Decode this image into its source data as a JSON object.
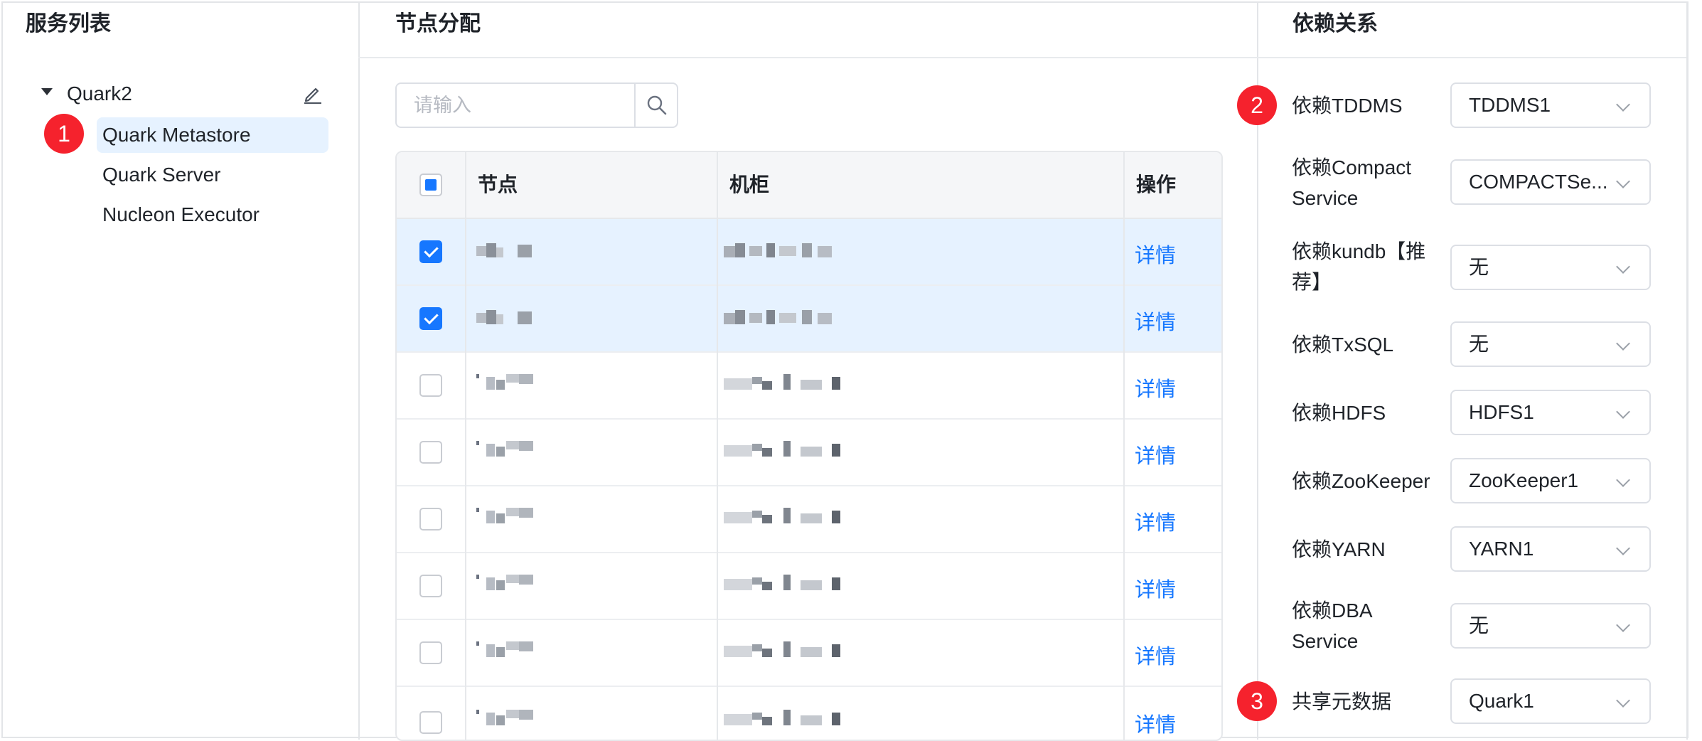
{
  "left_panel": {
    "title": "服务列表",
    "root": "Quark2",
    "items": [
      "Quark Metastore",
      "Quark Server",
      "Nucleon Executor"
    ],
    "selected_index": 0
  },
  "middle_panel": {
    "title": "节点分配",
    "search": {
      "placeholder": "请输入",
      "value": ""
    },
    "table": {
      "columns": [
        "节点",
        "机柜",
        "操作"
      ],
      "header_checkbox": "indeterminate",
      "rows": [
        {
          "checked": true,
          "action": "详情"
        },
        {
          "checked": true,
          "action": "详情"
        },
        {
          "checked": false,
          "action": "详情"
        },
        {
          "checked": false,
          "action": "详情"
        },
        {
          "checked": false,
          "action": "详情"
        },
        {
          "checked": false,
          "action": "详情"
        },
        {
          "checked": false,
          "action": "详情"
        },
        {
          "checked": false,
          "action": "详情"
        }
      ]
    }
  },
  "right_panel": {
    "title": "依赖关系",
    "deps": [
      {
        "label": "依赖TDDMS",
        "value": "TDDMS1"
      },
      {
        "label": "依赖Compact Service",
        "value": "COMPACTSe..."
      },
      {
        "label": "依赖kundb【推荐】",
        "value": "无"
      },
      {
        "label": "依赖TxSQL",
        "value": "无"
      },
      {
        "label": "依赖HDFS",
        "value": "HDFS1"
      },
      {
        "label": "依赖ZooKeeper",
        "value": "ZooKeeper1"
      },
      {
        "label": "依赖YARN",
        "value": "YARN1"
      },
      {
        "label": "依赖DBA Service",
        "value": "无"
      },
      {
        "label": "共享元数据",
        "value": "Quark1"
      }
    ]
  },
  "markers": [
    "1",
    "2",
    "3"
  ],
  "colors": {
    "accent": "#1677ff",
    "selected_bg": "#e6f2ff",
    "marker": "#f5222d"
  }
}
